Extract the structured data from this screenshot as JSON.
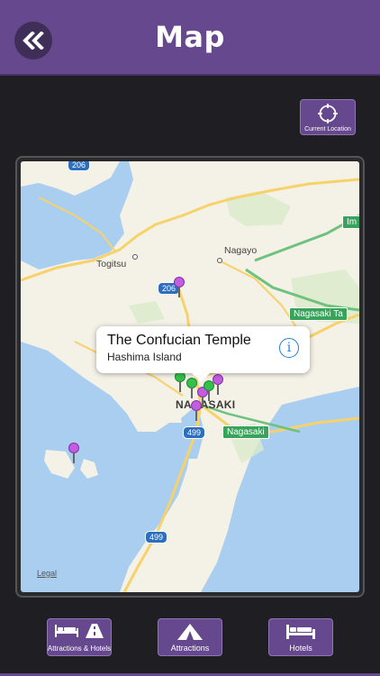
{
  "header": {
    "title": "Map",
    "back_icon": "double-chevron-left-icon"
  },
  "current_location": {
    "label": "Current Location",
    "icon": "crosshair-icon"
  },
  "map": {
    "place_labels": {
      "togitsu": "Togitsu",
      "nagayo": "Nagayo",
      "nagasaki_city": "NAGASAKI"
    },
    "road_signs": {
      "im": "Im",
      "nagasaki_ta": "Nagasaki Ta",
      "nagasaki": "Nagasaki"
    },
    "route_shields": {
      "r206_top": "206",
      "r206": "206",
      "r499_a": "499",
      "r499_b": "499"
    },
    "legal": "Legal",
    "callout": {
      "title": "The Confucian Temple",
      "subtitle": "Hashima Island",
      "info_icon": "info-icon"
    },
    "colors": {
      "water": "#a9cef0",
      "land": "#f4f1e6",
      "road": "#f7d26a",
      "pin": "#c15de0"
    }
  },
  "tabbar": {
    "attractions_hotels": "Attractions & Hotels",
    "attractions": "Attractions",
    "hotels": "Hotels"
  },
  "theme": {
    "header_bg": "#66488f",
    "background": "#1f1e22"
  }
}
